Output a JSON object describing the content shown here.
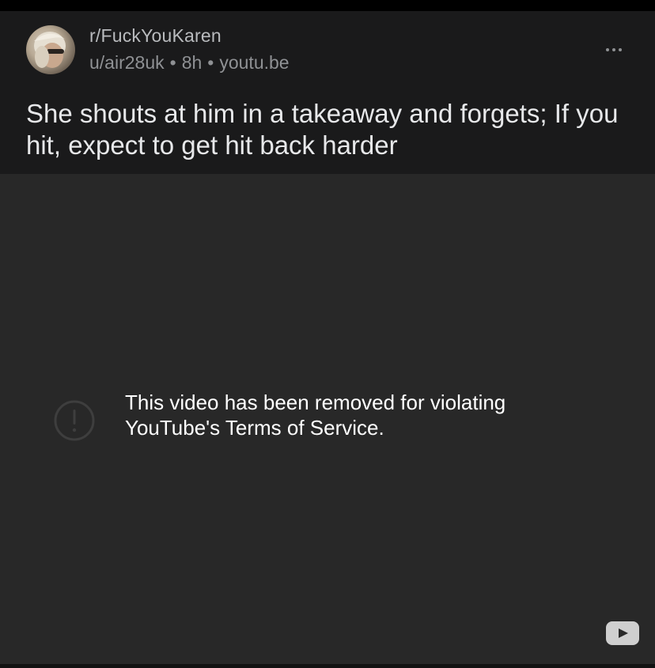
{
  "post": {
    "subreddit": "r/FuckYouKaren",
    "author": "u/air28uk",
    "age": "8h",
    "domain": "youtu.be",
    "separator": "•",
    "title": "She shouts at him in a takeaway and forgets; If you hit, expect to get hit back harder"
  },
  "video": {
    "error_message": "This video has been removed for violating YouTube's Terms of Service."
  },
  "icons": {
    "more": "more-dots-icon",
    "error": "exclamation-circle-icon",
    "youtube": "youtube-play-icon"
  },
  "colors": {
    "header_bg": "#1a1a1b",
    "video_bg": "#282828",
    "title_text": "#e7e8ea",
    "meta_text": "#8f9194"
  }
}
